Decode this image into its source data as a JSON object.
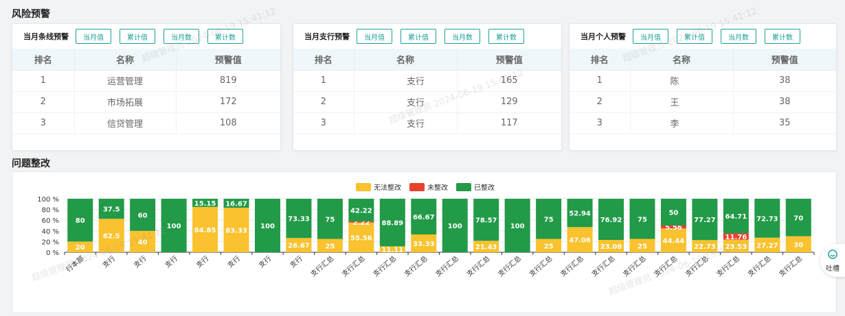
{
  "risk_title": "风险预警",
  "problem_title": "问题整改",
  "panels": [
    {
      "title": "当月条线预警",
      "buttons": [
        "当月值",
        "累计值",
        "当月数",
        "累计数"
      ],
      "columns": [
        "排名",
        "名称",
        "预警值"
      ],
      "rows": [
        [
          "1",
          "运营管理",
          "819"
        ],
        [
          "2",
          "市场拓展",
          "172"
        ],
        [
          "3",
          "信贷管理",
          "108"
        ]
      ]
    },
    {
      "title": "当月支行预警",
      "buttons": [
        "当月值",
        "累计值",
        "当月数",
        "累计数"
      ],
      "columns": [
        "排名",
        "名称",
        "预警值"
      ],
      "rows": [
        [
          "1",
          "支行",
          "165"
        ],
        [
          "2",
          "支行",
          "129"
        ],
        [
          "3",
          "支行",
          "117"
        ]
      ]
    },
    {
      "title": "当月个人预警",
      "buttons": [
        "当月值",
        "累计值",
        "当月数",
        "累计数"
      ],
      "columns": [
        "排名",
        "名称",
        "预警值"
      ],
      "rows": [
        [
          "1",
          "陈",
          "38"
        ],
        [
          "2",
          "王",
          "38"
        ],
        [
          "3",
          "李",
          "35"
        ]
      ]
    }
  ],
  "side_button": {
    "label": "吐槽",
    "icon": "chat-bubble-icon"
  },
  "colors": {
    "unable": "#f9c22e",
    "pending": "#e8422f",
    "done": "#229a48",
    "accent": "#1aa09a"
  },
  "chart_data": {
    "type": "bar",
    "stacked": true,
    "y_tick_labels": [
      "0 %",
      "20 %",
      "40 %",
      "60 %",
      "80 %",
      "100 %"
    ],
    "ylim": [
      0,
      100
    ],
    "legend": [
      "无法整改",
      "未整改",
      "已整改"
    ],
    "legend_position": "top-center",
    "categories": [
      "行本部",
      "支行",
      "支行",
      "支行",
      "支行",
      "支行",
      "支行",
      "支行",
      "支行汇总",
      "支行汇总",
      "支行汇总",
      "支行汇总",
      "支行汇总",
      "支行汇总",
      "支行汇总",
      "支行汇总",
      "支行汇总",
      "支行汇总",
      "支行汇总",
      "支行汇总",
      "支行汇总",
      "支行汇总",
      "支行汇总",
      "支行汇总"
    ],
    "series": [
      {
        "name": "无法整改",
        "values": [
          20,
          62.5,
          40,
          0,
          84.85,
          83.33,
          0,
          26.67,
          25,
          55.56,
          11.11,
          33.33,
          0,
          21.43,
          0,
          25,
          47.06,
          23.08,
          25,
          44.44,
          22.73,
          23.53,
          27.27,
          30
        ]
      },
      {
        "name": "未整改",
        "values": [
          0,
          0,
          0,
          0,
          0,
          0,
          0,
          0,
          0,
          2.22,
          0,
          0,
          0,
          0,
          0,
          0,
          0,
          0,
          0,
          5.56,
          0,
          11.76,
          0,
          0
        ]
      },
      {
        "name": "已整改",
        "values": [
          80,
          37.5,
          60,
          100,
          15.15,
          16.67,
          100,
          73.33,
          75,
          42.22,
          88.89,
          66.67,
          100,
          78.57,
          100,
          75,
          52.94,
          76.92,
          75,
          50,
          77.27,
          64.71,
          72.73,
          70
        ]
      }
    ]
  },
  "watermark_text": "超级管理员 2024-06-19 15:41:12"
}
